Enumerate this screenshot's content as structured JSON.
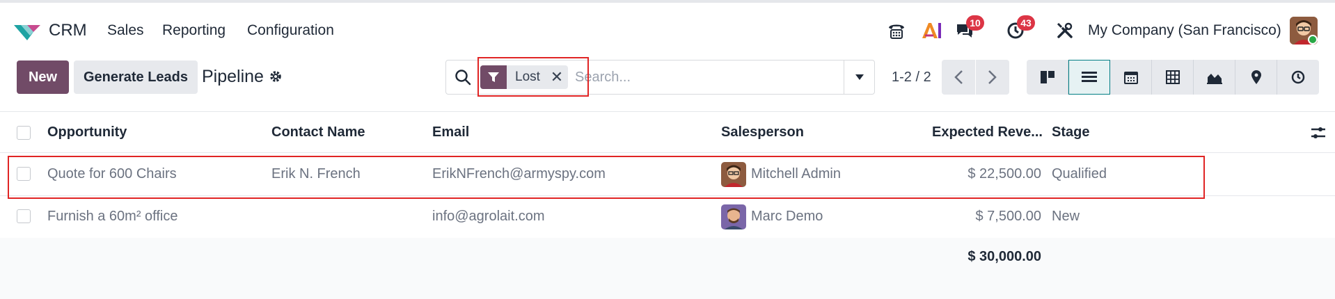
{
  "navbar": {
    "app_name": "CRM",
    "menu": [
      "Sales",
      "Reporting",
      "Configuration"
    ],
    "systray": {
      "phone_icon": "phone-icon",
      "ai_icon": "ai-icon",
      "messages_count": "10",
      "activities_count": "43",
      "debug_icon": "tools-icon"
    },
    "company": "My Company (San Francisco)"
  },
  "control_panel": {
    "new_label": "New",
    "generate_label": "Generate Leads",
    "breadcrumb": "Pipeline",
    "search": {
      "facet_label": "Lost",
      "placeholder": "Search..."
    },
    "pager": "1-2 / 2",
    "views": [
      "kanban",
      "list",
      "calendar",
      "pivot",
      "graph",
      "map",
      "activity"
    ],
    "active_view": "list"
  },
  "list": {
    "columns": [
      "Opportunity",
      "Contact Name",
      "Email",
      "Salesperson",
      "Expected Reve...",
      "Stage"
    ],
    "rows": [
      {
        "opportunity": "Quote for 600 Chairs",
        "contact": "Erik N. French",
        "email": "ErikNFrench@armyspy.com",
        "salesperson": "Mitchell Admin",
        "revenue": "$ 22,500.00",
        "stage": "Qualified"
      },
      {
        "opportunity": "Furnish a 60m² office",
        "contact": "",
        "email": "info@agrolait.com",
        "salesperson": "Marc Demo",
        "revenue": "$ 7,500.00",
        "stage": "New"
      }
    ],
    "total_revenue": "$ 30,000.00"
  },
  "colors": {
    "brand": "#714b67",
    "highlight_border": "#e02424",
    "badge": "#dc3545",
    "active_view": "#017e84"
  }
}
